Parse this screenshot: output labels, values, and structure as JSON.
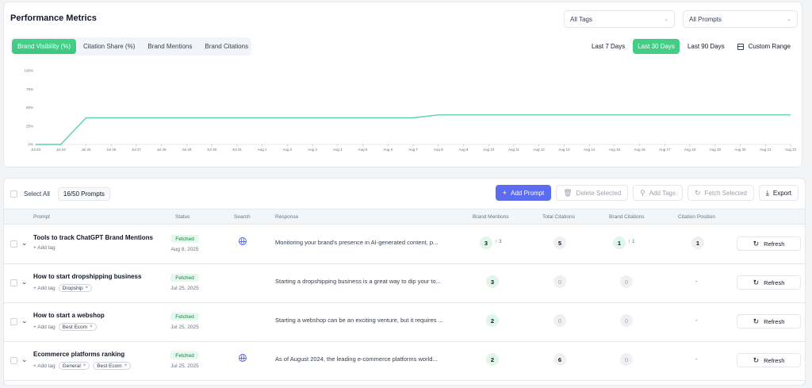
{
  "performance": {
    "title": "Performance Metrics",
    "tags_select": "All Tags",
    "prompts_select": "All Prompts",
    "metric_tabs": [
      {
        "label": "Brand Visibility (%)",
        "active": true
      },
      {
        "label": "Citation Share (%)",
        "active": false
      },
      {
        "label": "Brand Mentions",
        "active": false
      },
      {
        "label": "Brand Citations",
        "active": false
      }
    ],
    "ranges": [
      {
        "label": "Last 7 Days",
        "active": false
      },
      {
        "label": "Last 30 Days",
        "active": true
      },
      {
        "label": "Last 90 Days",
        "active": false
      }
    ],
    "custom_range": "Custom Range"
  },
  "chart_data": {
    "type": "line",
    "x": [
      "Jul 23",
      "Jul 24",
      "Jul 25",
      "Jul 26",
      "Jul 27",
      "Jul 28",
      "Jul 29",
      "Jul 30",
      "Jul 31",
      "Aug 1",
      "Aug 2",
      "Aug 3",
      "Aug 4",
      "Aug 5",
      "Aug 6",
      "Aug 7",
      "Aug 8",
      "Aug 9",
      "Aug 10",
      "Aug 11",
      "Aug 12",
      "Aug 13",
      "Aug 14",
      "Aug 15",
      "Aug 16",
      "Aug 17",
      "Aug 18",
      "Aug 19",
      "Aug 20",
      "Aug 21",
      "Aug 22"
    ],
    "series": [
      {
        "values": [
          0,
          0,
          36,
          36,
          36,
          36,
          36,
          36,
          36,
          36,
          36,
          36,
          36,
          36,
          36,
          36,
          40,
          40,
          40,
          40,
          40,
          40,
          40,
          40,
          40,
          40,
          40,
          40,
          40,
          40,
          40
        ]
      }
    ],
    "y_ticks": [
      "0%",
      "25%",
      "50%",
      "75%",
      "100%"
    ],
    "ylim": [
      0,
      100
    ],
    "color": "#5fd3a2",
    "grid": false
  },
  "prompts": {
    "select_all": "Select All",
    "count": "16/50 Prompts",
    "add_prompt": "Add Prompt",
    "delete_selected": "Delete Selected",
    "add_tags": "Add Tags",
    "fetch_selected": "Fetch Selected",
    "export": "Export",
    "columns": {
      "prompt": "Prompt",
      "status": "Status",
      "search": "Search",
      "response": "Response",
      "brand_mentions": "Brand Mentions",
      "total_citations": "Total Citations",
      "brand_citations": "Brand Citations",
      "citation_position": "Citation Position"
    },
    "add_tag_label": "+ Add tag",
    "refresh_label": "Refresh",
    "rows": [
      {
        "prompt": "Tools to track ChatGPT Brand Mentions",
        "tags": [],
        "status": "Fetched",
        "date": "Aug 8, 2025",
        "search": true,
        "response": "Monitoring your brand's presence in AI-generated content, p...",
        "brand_mentions": "3",
        "brand_mentions_delta": "↑ 3",
        "total_citations": "5",
        "brand_citations": "1",
        "brand_citations_delta": "↑ 1",
        "citation_position": "1"
      },
      {
        "prompt": "How to start dropshipping business",
        "tags": [
          "Dropship"
        ],
        "status": "Fetched",
        "date": "Jul 25, 2025",
        "search": false,
        "response": "Starting a dropshipping business is a great way to dip your to...",
        "brand_mentions": "3",
        "brand_mentions_delta": "",
        "total_citations": "0",
        "brand_citations": "0",
        "brand_citations_delta": "",
        "citation_position": "-"
      },
      {
        "prompt": "How to start a webshop",
        "tags": [
          "Best Ecom"
        ],
        "status": "Fetched",
        "date": "Jul 25, 2025",
        "search": false,
        "response": "Starting a webshop can be an exciting venture, but it requires ...",
        "brand_mentions": "2",
        "brand_mentions_delta": "",
        "total_citations": "0",
        "brand_citations": "0",
        "brand_citations_delta": "",
        "citation_position": "-"
      },
      {
        "prompt": "Ecommerce platforms ranking",
        "tags": [
          "General",
          "Best Ecom"
        ],
        "status": "Fetched",
        "date": "Jul 25, 2025",
        "search": true,
        "response": "As of August 2024, the leading e-commerce platforms world...",
        "brand_mentions": "2",
        "brand_mentions_delta": "",
        "total_citations": "6",
        "brand_citations": "0",
        "brand_citations_delta": "",
        "citation_position": "-"
      }
    ]
  }
}
